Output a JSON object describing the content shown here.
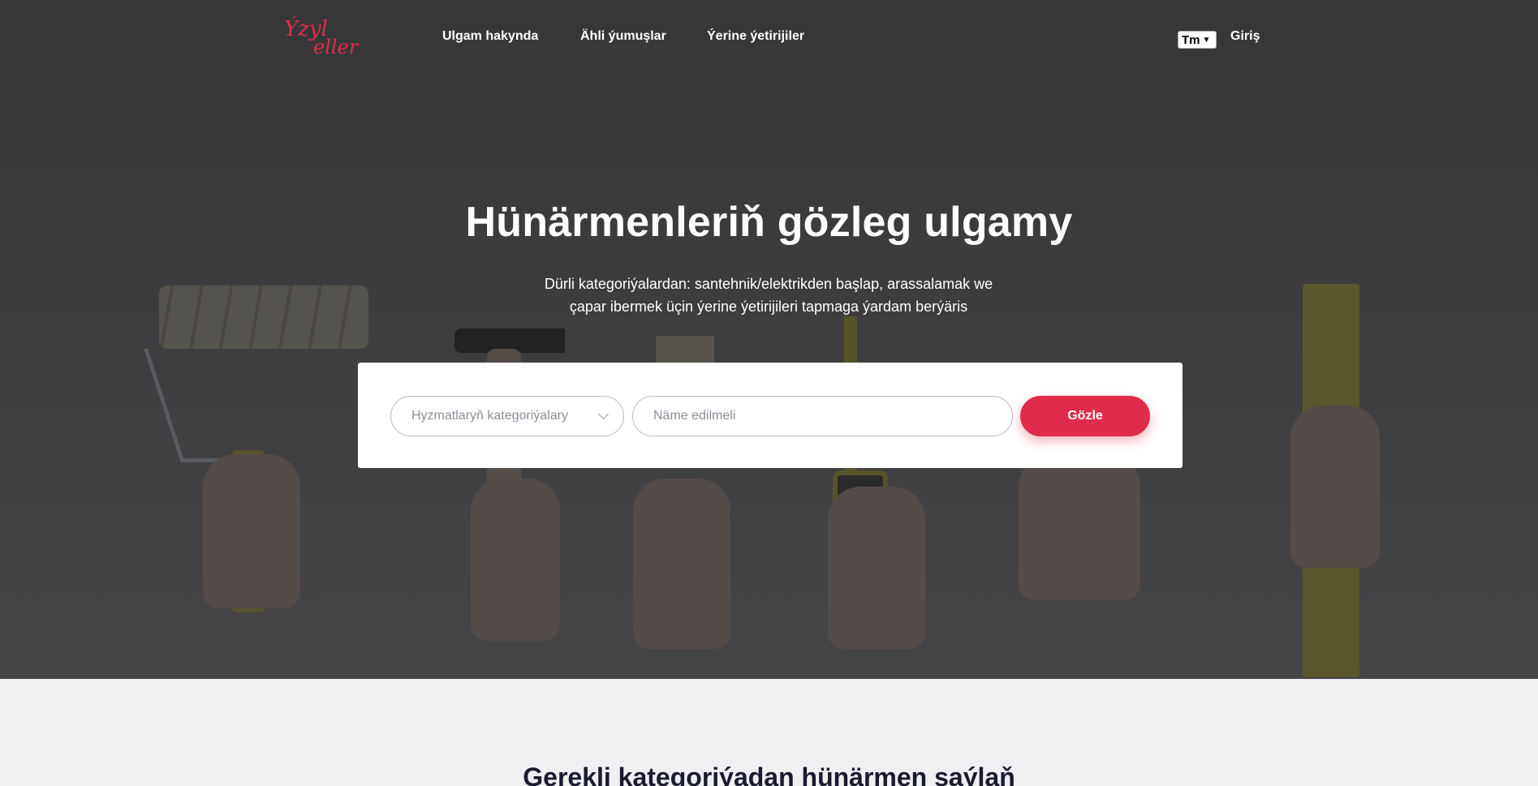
{
  "brand": {
    "logo_text_top": "Ýzyl",
    "logo_text_bottom": "eller",
    "logo_color": "#df2c4a"
  },
  "nav": {
    "items": [
      {
        "label": "Ulgam hakynda"
      },
      {
        "label": "Ähli ýumuşlar"
      },
      {
        "label": "Ýerine ýetirijiler"
      }
    ],
    "language": "Tm",
    "login": "Giriş"
  },
  "hero": {
    "title": "Hünärmenleriň gözleg ulgamy",
    "subtitle": "Dürli kategoriýalardan: santehnik/elektrikden başlap, arassalamak we çapar ibermek üçin ýerine ýetirijileri tapmaga ýardam berýäris"
  },
  "search": {
    "category_placeholder": "Hyzmatlaryň kategoriýalary",
    "name_placeholder": "Näme edilmeli",
    "button_label": "Gözle",
    "button_color": "#df2c4a"
  },
  "section": {
    "title": "Gerekli kategoriýadan hünärmen saýlaň"
  },
  "colors": {
    "hero_bg": "#454547",
    "page_bg": "#f0f0f3",
    "text_dark": "#1a1b2e"
  }
}
